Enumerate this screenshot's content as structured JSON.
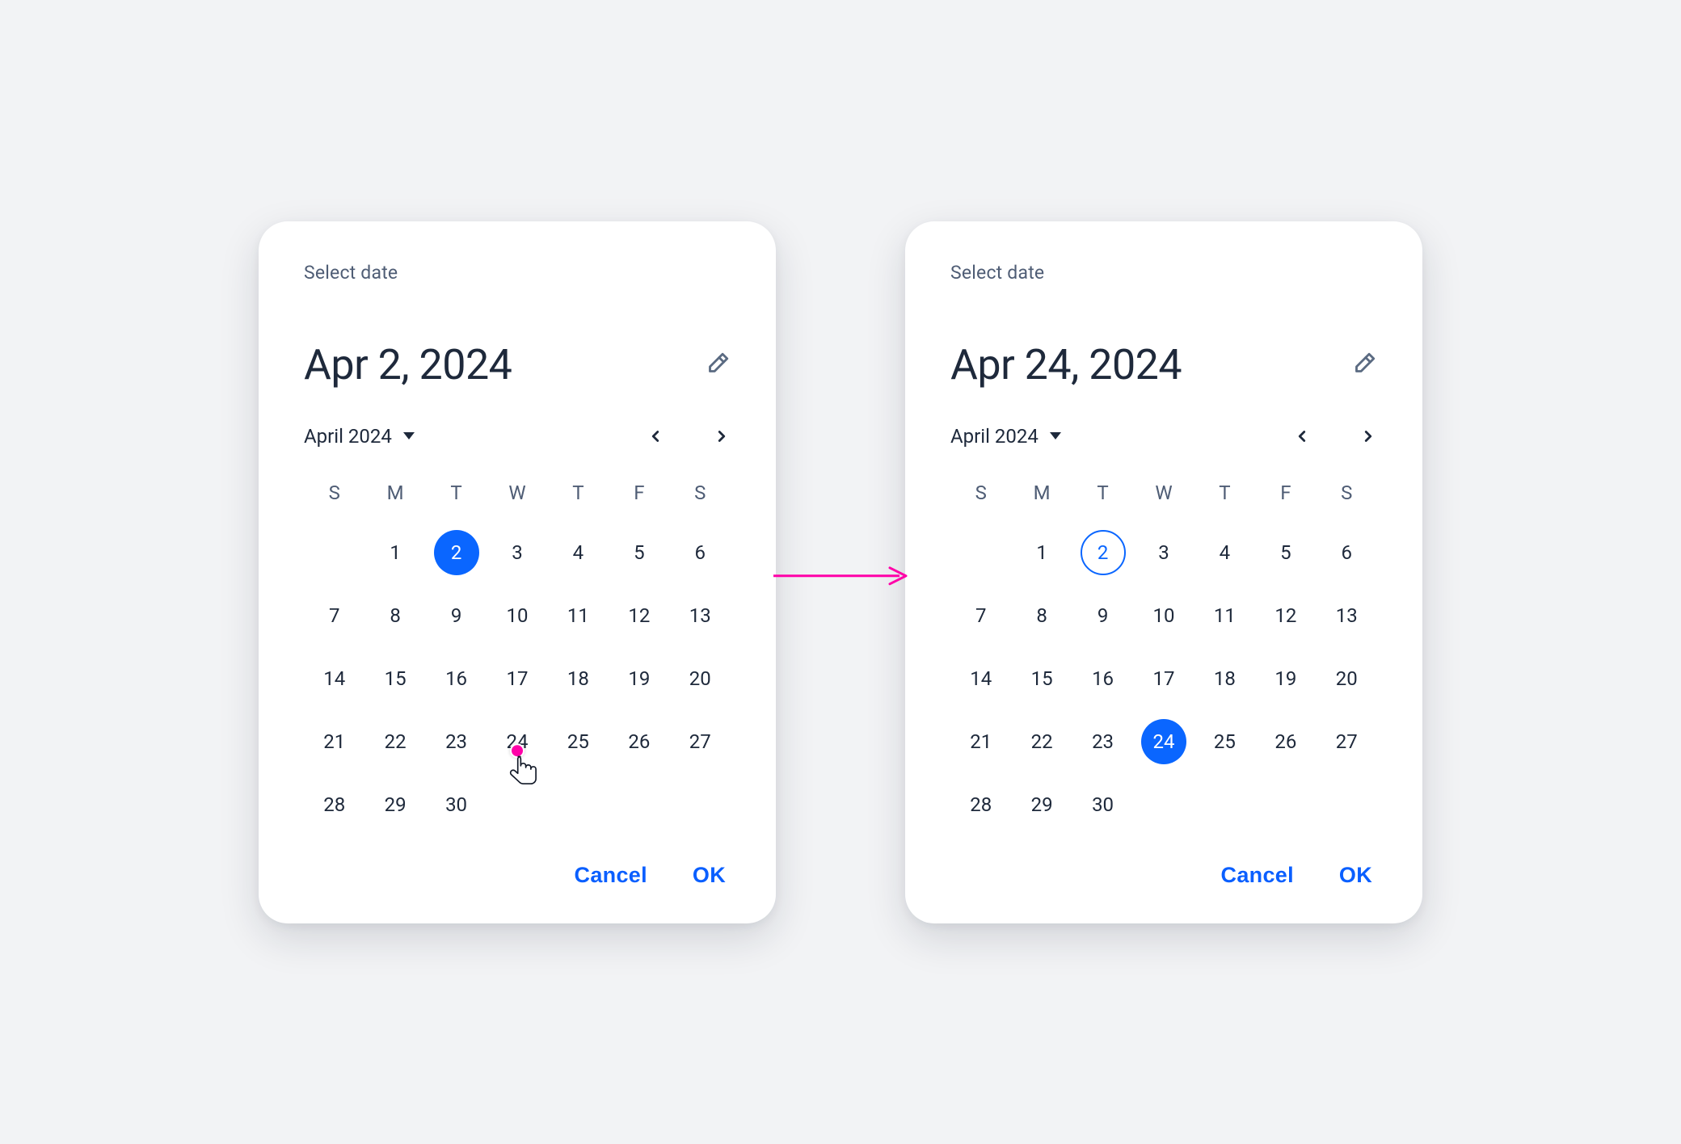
{
  "common": {
    "label": "Select date",
    "month_label": "April 2024",
    "weekdays": [
      "S",
      "M",
      "T",
      "W",
      "T",
      "F",
      "S"
    ],
    "days": [
      "",
      "1",
      "2",
      "3",
      "4",
      "5",
      "6",
      "7",
      "8",
      "9",
      "10",
      "11",
      "12",
      "13",
      "14",
      "15",
      "16",
      "17",
      "18",
      "19",
      "20",
      "21",
      "22",
      "23",
      "24",
      "25",
      "26",
      "27",
      "28",
      "29",
      "30"
    ],
    "cancel": "Cancel",
    "ok": "OK"
  },
  "panels": [
    {
      "headline": "Apr 2, 2024",
      "selected": "2",
      "today": null,
      "tap_target": "24"
    },
    {
      "headline": "Apr 24, 2024",
      "selected": "24",
      "today": "2",
      "tap_target": null
    }
  ]
}
